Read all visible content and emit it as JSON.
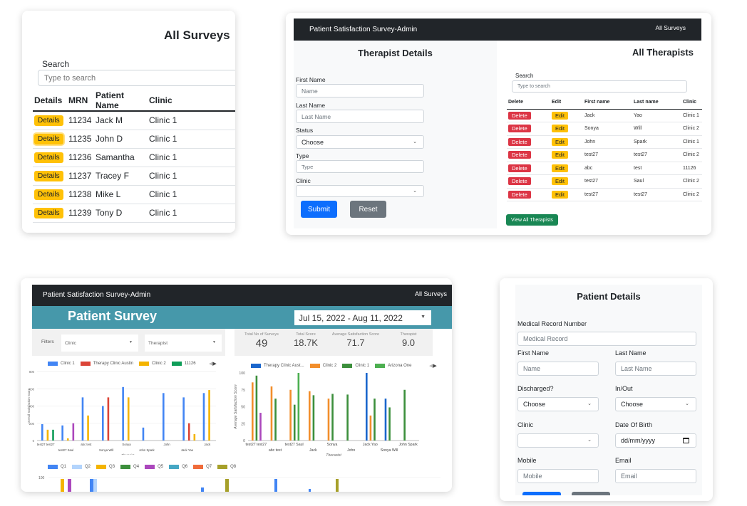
{
  "all_surveys": {
    "title": "All Surveys",
    "search_label": "Search",
    "search_placeholder": "Type to search",
    "columns": [
      "Details",
      "MRN",
      "Patient Name",
      "Clinic"
    ],
    "details_button_label": "Details",
    "rows": [
      {
        "mrn": "11234",
        "name": "Jack M",
        "clinic": "Clinic 1"
      },
      {
        "mrn": "11235",
        "name": "John D",
        "clinic": "Clinic 1"
      },
      {
        "mrn": "11236",
        "name": "Samantha",
        "clinic": "Clinic 1"
      },
      {
        "mrn": "11237",
        "name": "Tracey F",
        "clinic": "Clinic 1"
      },
      {
        "mrn": "11238",
        "name": "Mike L",
        "clinic": "Clinic 1"
      },
      {
        "mrn": "11239",
        "name": "Tony D",
        "clinic": "Clinic 1"
      }
    ]
  },
  "therapists_page": {
    "navbar": {
      "brand": "Patient Satisfaction Survey-Admin",
      "link": "All Surveys"
    },
    "form": {
      "title": "Therapist Details",
      "first_name_label": "First Name",
      "first_name_placeholder": "Name",
      "last_name_label": "Last Name",
      "last_name_placeholder": "Last Name",
      "status_label": "Status",
      "status_value": "Choose",
      "type_label": "Type",
      "type_placeholder": "Type",
      "clinic_label": "Clinic",
      "clinic_value": "",
      "submit_label": "Submit",
      "reset_label": "Reset"
    },
    "list": {
      "title": "All Therapists",
      "search_label": "Search",
      "search_placeholder": "Type to search",
      "columns": [
        "Delete",
        "Edit",
        "First name",
        "Last name",
        "Clinic"
      ],
      "delete_label": "Delete",
      "edit_label": "Edit",
      "rows": [
        {
          "first": "Jack",
          "last": "Yao",
          "clinic": "Clinic 1"
        },
        {
          "first": "Sonya",
          "last": "Will",
          "clinic": "Clinic 2"
        },
        {
          "first": "John",
          "last": "Spark",
          "clinic": "Clinic 1"
        },
        {
          "first": "test27",
          "last": "test27",
          "clinic": "Clinic 2"
        },
        {
          "first": "abc",
          "last": "test",
          "clinic": "11126"
        },
        {
          "first": "test27",
          "last": "Saul",
          "clinic": "Clinic 2"
        },
        {
          "first": "test27",
          "last": "test27",
          "clinic": "Clinic 2"
        }
      ],
      "view_all_label": "View All Therapists"
    }
  },
  "dashboard": {
    "navbar": {
      "brand": "Patient Satisfaction Survey-Admin",
      "link": "All Surveys"
    },
    "title": "Patient Survey",
    "date_range": "Jul 15, 2022 - Aug 11, 2022",
    "filters": {
      "label": "Filters",
      "clinic": "Clinic",
      "therapist": "Therapist"
    },
    "kpis": [
      {
        "label": "Total No of Surveys",
        "value": "49"
      },
      {
        "label": "Total Score",
        "value": "18.7K"
      },
      {
        "label": "Average Satisfaction Score",
        "value": "71.7"
      },
      {
        "label": "Therapist",
        "value": "9.0"
      }
    ]
  },
  "chart_data": [
    {
      "type": "bar",
      "title": "",
      "xlabel": "Therapist",
      "ylabel": "Overall Satisfaction Score",
      "ylim": [
        0,
        800
      ],
      "yticks": [
        0,
        200,
        400,
        600,
        800
      ],
      "grid": true,
      "legend_position": "top",
      "legend": [
        {
          "name": "Clinic 1",
          "color": "#4285f4"
        },
        {
          "name": "Therapy Clinic Austin",
          "color": "#db4437"
        },
        {
          "name": "Clinic 2",
          "color": "#f4b400"
        },
        {
          "name": "11126",
          "color": "#0f9d58"
        }
      ],
      "categories": [
        "test27 test27",
        "test27 Saul",
        "abc test",
        "Sonya Will",
        "Sonya",
        "John Spark",
        "John",
        "Jack Yao",
        "Jack"
      ],
      "bars": [
        [
          {
            "color": "#4285f4",
            "value": 190
          },
          {
            "color": "#f4b400",
            "value": 125
          },
          {
            "color": "#0f9d58",
            "value": 125
          }
        ],
        [
          {
            "color": "#4285f4",
            "value": 175
          },
          {
            "color": "#f4b400",
            "value": 25
          },
          {
            "color": "#ab47bc",
            "value": 200
          }
        ],
        [
          {
            "color": "#4285f4",
            "value": 500
          },
          {
            "color": "#f4b400",
            "value": 290
          }
        ],
        [
          {
            "color": "#4285f4",
            "value": 400
          },
          {
            "color": "#db4437",
            "value": 500
          }
        ],
        [
          {
            "color": "#4285f4",
            "value": 620
          },
          {
            "color": "#f4b400",
            "value": 500
          }
        ],
        [
          {
            "color": "#4285f4",
            "value": 150
          }
        ],
        [
          {
            "color": "#4285f4",
            "value": 550
          }
        ],
        [
          {
            "color": "#4285f4",
            "value": 500
          },
          {
            "color": "#db4437",
            "value": 200
          },
          {
            "color": "#f4b400",
            "value": 75
          }
        ],
        [
          {
            "color": "#4285f4",
            "value": 550
          },
          {
            "color": "#f4b400",
            "value": 585
          }
        ]
      ]
    },
    {
      "type": "bar",
      "title": "",
      "xlabel": "Therapist",
      "ylabel": "Average Satisfaction Score",
      "ylim": [
        0,
        100
      ],
      "yticks": [
        0,
        25,
        50,
        75,
        100
      ],
      "grid": false,
      "legend_position": "top",
      "legend": [
        {
          "name": "Therapy Clinic Aust...",
          "color": "#1a66cc"
        },
        {
          "name": "Clinic 2",
          "color": "#f28e2b"
        },
        {
          "name": "Clinic 1",
          "color": "#3c8f3c"
        },
        {
          "name": "Arizona One",
          "color": "#4caf50"
        }
      ],
      "categories": [
        "test27 test27",
        "abc test",
        "test27 Saul",
        "Jack",
        "Sonya",
        "John",
        "Jack Yao",
        "Sonya Will",
        "John Spark"
      ],
      "bars": [
        [
          {
            "color": "#f28e2b",
            "value": 86
          },
          {
            "color": "#3c8f3c",
            "value": 96
          },
          {
            "color": "#ab47bc",
            "value": 41
          }
        ],
        [
          {
            "color": "#f28e2b",
            "value": 80
          },
          {
            "color": "#3c8f3c",
            "value": 62
          }
        ],
        [
          {
            "color": "#f28e2b",
            "value": 75
          },
          {
            "color": "#3c8f3c",
            "value": 53
          },
          {
            "color": "#4caf50",
            "value": 100
          }
        ],
        [
          {
            "color": "#f28e2b",
            "value": 73
          },
          {
            "color": "#3c8f3c",
            "value": 67
          }
        ],
        [
          {
            "color": "#f28e2b",
            "value": 62
          },
          {
            "color": "#3c8f3c",
            "value": 69
          }
        ],
        [
          {
            "color": "#3c8f3c",
            "value": 68
          }
        ],
        [
          {
            "color": "#1a66cc",
            "value": 100
          },
          {
            "color": "#f28e2b",
            "value": 37
          },
          {
            "color": "#3c8f3c",
            "value": 62
          }
        ],
        [
          {
            "color": "#1a66cc",
            "value": 62
          },
          {
            "color": "#3c8f3c",
            "value": 49
          }
        ],
        [
          {
            "color": "#3c8f3c",
            "value": 75
          }
        ]
      ]
    },
    {
      "type": "bar",
      "title": "",
      "ylabel": "",
      "yticks": [
        100
      ],
      "legend_position": "top",
      "legend": [
        {
          "name": "Q1",
          "color": "#4285f4"
        },
        {
          "name": "Q2",
          "color": "#b3d4fc"
        },
        {
          "name": "Q3",
          "color": "#f4b400"
        },
        {
          "name": "Q4",
          "color": "#3c8f3c"
        },
        {
          "name": "Q5",
          "color": "#ab47bc"
        },
        {
          "name": "Q6",
          "color": "#46a7c4"
        },
        {
          "name": "Q7",
          "color": "#f06b3a"
        },
        {
          "name": "Q8",
          "color": "#a6a02a"
        }
      ],
      "note": "chart partially cut off; only bar tops visible"
    }
  ],
  "patient_details": {
    "title": "Patient Details",
    "mrn_label": "Medical Record Number",
    "mrn_placeholder": "Medical Record",
    "first_name_label": "First Name",
    "first_name_placeholder": "Name",
    "last_name_label": "Last Name",
    "last_name_placeholder": "Last Name",
    "discharged_label": "Discharged?",
    "discharged_value": "Choose",
    "inout_label": "In/Out",
    "inout_value": "Choose",
    "clinic_label": "Clinic",
    "clinic_value": "",
    "dob_label": "Date Of Birth",
    "dob_placeholder": "dd/mm/yyyy",
    "mobile_label": "Mobile",
    "mobile_placeholder": "Mobile",
    "email_label": "Email",
    "email_placeholder": "Email"
  }
}
